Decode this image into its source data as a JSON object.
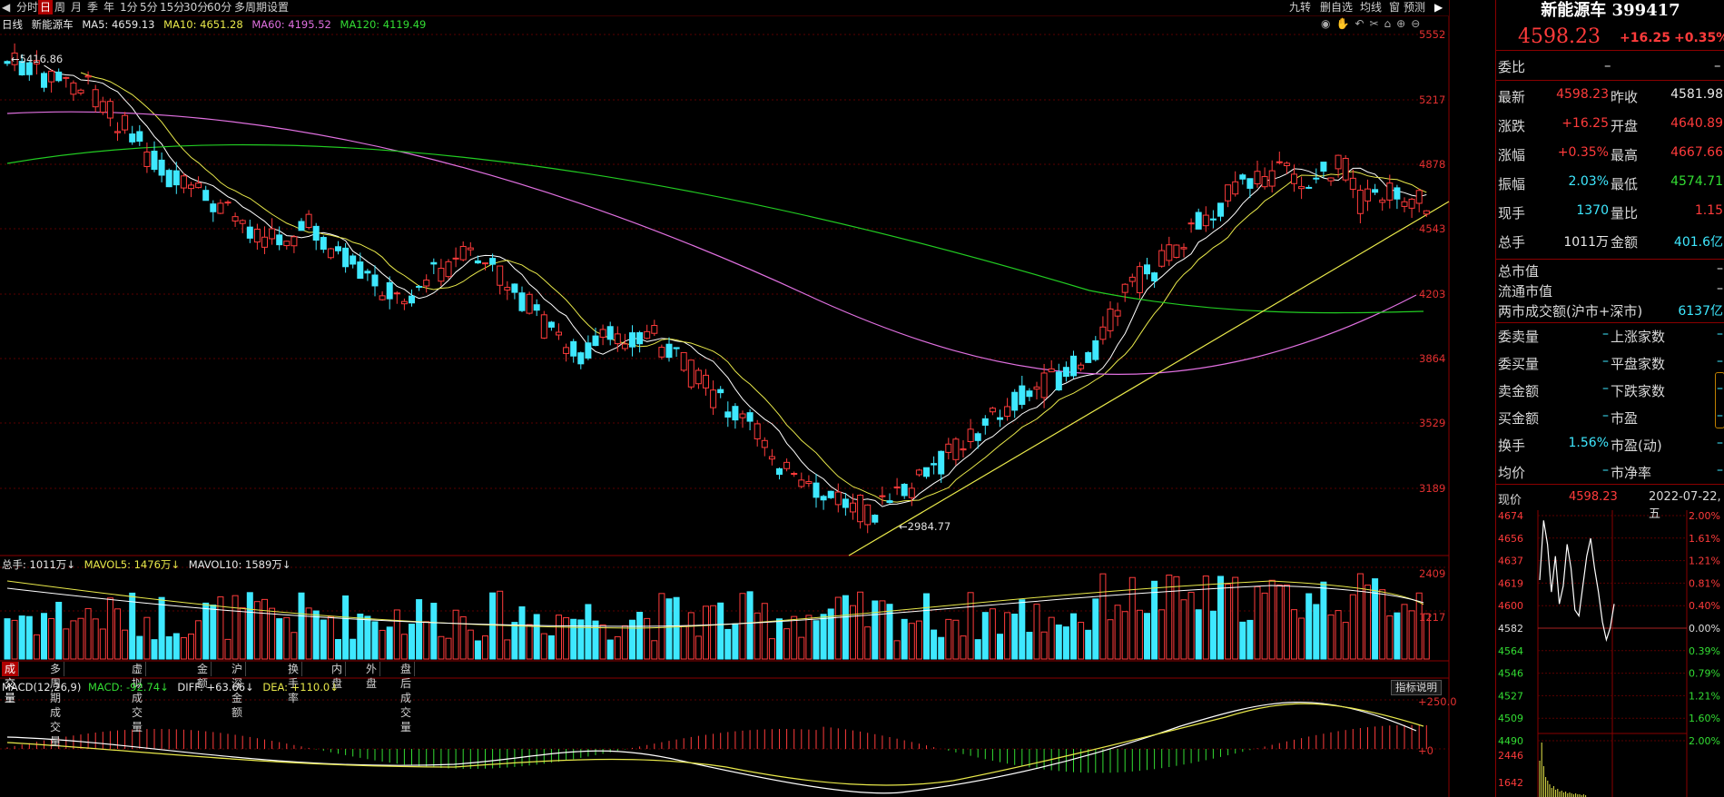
{
  "topbar": {
    "tabs": [
      "分时",
      "日",
      "周",
      "月",
      "季",
      "年",
      "1分",
      "5分",
      "15分",
      "30分",
      "60分",
      "多周期",
      "设置"
    ],
    "active_tab": "日",
    "right_tools": [
      "九转",
      "删自选",
      "均线",
      "窗",
      "预测"
    ]
  },
  "ma_line": {
    "period": "日线",
    "name": "新能源车",
    "ma5": "MA5: 4659.13",
    "ma10": "MA10: 4651.28",
    "ma60": "MA60: 4195.52",
    "ma120": "MA120: 4119.49"
  },
  "price_axis": [
    "5552",
    "5217",
    "4878",
    "4543",
    "4203",
    "3864",
    "3529",
    "3189"
  ],
  "annotations": {
    "high": "5416.86",
    "low": "2984.77"
  },
  "volume_line": {
    "total": "总手: 1011万",
    "mavol5": "MAVOL5: 1476万",
    "mavol10": "MAVOL10: 1589万"
  },
  "volume_axis": [
    "2409",
    "1217"
  ],
  "bottom_tabs": [
    "成交量",
    "多周期成交量",
    "虚拟成交量",
    "金额",
    "沪深金额",
    "换手率",
    "内盘",
    "外盘",
    "盘后成交量"
  ],
  "macd_line": {
    "name": "MACD(12,26,9)",
    "macd": "MACD: -92.74",
    "diff": "DIFF: +63.66",
    "dea": "DEA: +110.0"
  },
  "macd_axis": [
    "+250.0",
    "+0"
  ],
  "macd_help": "指标说明",
  "side": {
    "title": "新能源车 399417",
    "price": "4598.23",
    "change": "+16.25",
    "change_pct": "+0.35%",
    "weibi_label": "委比",
    "weibi_value": "–",
    "weibi_value2": "–",
    "rows": [
      {
        "l1": "最新",
        "v1": "4598.23",
        "c1": "red",
        "l2": "昨收",
        "v2": "4581.98",
        "c2": "white"
      },
      {
        "l1": "涨跌",
        "v1": "+16.25",
        "c1": "red",
        "l2": "开盘",
        "v2": "4640.89",
        "c2": "red"
      },
      {
        "l1": "涨幅",
        "v1": "+0.35%",
        "c1": "red",
        "l2": "最高",
        "v2": "4667.66",
        "c2": "red"
      },
      {
        "l1": "振幅",
        "v1": "2.03%",
        "c1": "cyan",
        "l2": "最低",
        "v2": "4574.71",
        "c2": "green"
      },
      {
        "l1": "现手",
        "v1": "1370",
        "c1": "cyan",
        "l2": "量比",
        "v2": "1.15",
        "c2": "red"
      },
      {
        "l1": "总手",
        "v1": "1011万",
        "c1": "white",
        "l2": "金额",
        "v2": "401.6亿",
        "c2": "cyan"
      }
    ],
    "market_rows": [
      {
        "label": "总市值",
        "value": "–"
      },
      {
        "label": "流通市值",
        "value": "–"
      },
      {
        "label": "两市成交额(沪市+深市)",
        "value": "6137亿"
      }
    ],
    "stat_rows": [
      {
        "l1": "委卖量",
        "v1": "–",
        "l2": "上涨家数",
        "v2": "–"
      },
      {
        "l1": "委买量",
        "v1": "–",
        "l2": "平盘家数",
        "v2": "–"
      },
      {
        "l1": "卖金额",
        "v1": "–",
        "l2": "下跌家数",
        "v2": "–"
      },
      {
        "l1": "买金额",
        "v1": "–",
        "l2": "市盈",
        "v2": "–"
      },
      {
        "l1": "换手",
        "v1": "1.56%",
        "l2": "市盈(动)",
        "v2": "–"
      },
      {
        "l1": "均价",
        "v1": "–",
        "l2": "市净率",
        "v2": "–"
      }
    ],
    "mini": {
      "label": "现价",
      "price": "4598.23",
      "date": "2022-07-22,五",
      "left_axis": [
        "4674",
        "4656",
        "4637",
        "4619",
        "4600",
        "4582",
        "4564",
        "4546",
        "4527",
        "4509",
        "4490"
      ],
      "right_axis": [
        "2.00%",
        "1.61%",
        "1.21%",
        "0.81%",
        "0.40%",
        "0.00%",
        "0.39%",
        "0.79%",
        "1.21%",
        "1.60%",
        "2.00%"
      ],
      "vol_axis": [
        "2446",
        "1642"
      ]
    }
  },
  "colors": {
    "up": "#ff3b3b",
    "down": "#3ee8ff",
    "ma5": "#ffffff",
    "ma10": "#e8e84a",
    "ma60": "#e070e0",
    "ma120": "#22cc22",
    "trend": "#e8e84a"
  }
}
